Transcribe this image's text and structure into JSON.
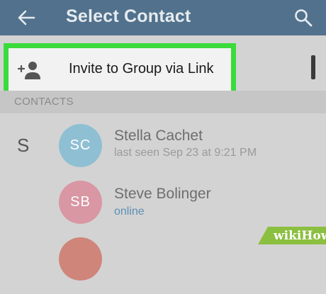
{
  "header": {
    "title": "Select Contact",
    "back_icon": "arrow-left-icon",
    "search_icon": "search-icon"
  },
  "invite": {
    "label": "Invite to Group via Link",
    "icon": "add-person-icon",
    "highlight_color": "#3bdb3b"
  },
  "section": {
    "header": "CONTACTS",
    "letter": "S"
  },
  "contacts": [
    {
      "initials": "SC",
      "name": "Stella Cachet",
      "status": "last seen Sep 23 at 9:21 PM",
      "avatar_color": "#8fbfd3",
      "status_color": "#9a9a9a"
    },
    {
      "initials": "SB",
      "name": "Steve Bolinger",
      "status": "online",
      "avatar_color": "#d996a3",
      "status_color": "#5c8fb5"
    },
    {
      "initials": "",
      "name": "",
      "status": "",
      "avatar_color": "#cf8579",
      "status_color": "#9a9a9a"
    }
  ],
  "watermark": {
    "prefix": "wiki",
    "suffix": "How"
  },
  "colors": {
    "appbar": "#51718c",
    "background": "#d3d3d3"
  }
}
